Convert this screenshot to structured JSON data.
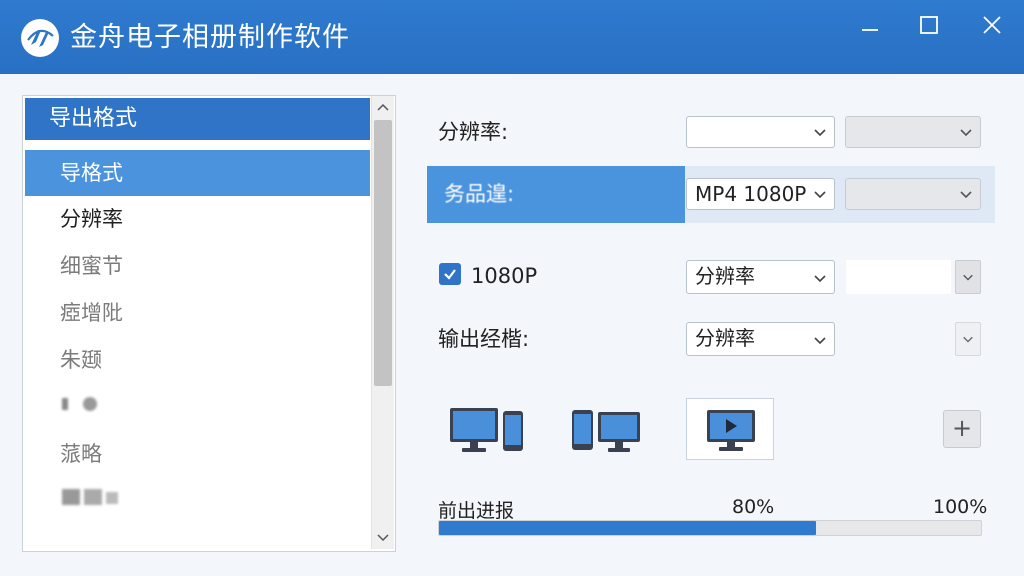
{
  "window": {
    "title": "金舟电子相册制作软件",
    "accent_color": "#2f74c6",
    "controls": [
      "minimize-icon",
      "maximize-icon",
      "close-icon"
    ]
  },
  "sidebar": {
    "header": "导出格式",
    "items": [
      {
        "label": "导格式",
        "state": "selected"
      },
      {
        "label": "分辨率",
        "state": "normal"
      },
      {
        "label": "细蜜节",
        "state": "muted"
      },
      {
        "label": "瘂增阰",
        "state": "muted"
      },
      {
        "label": "朱颋",
        "state": "muted"
      },
      {
        "label": "",
        "state": "blurred"
      },
      {
        "label": "蒎略",
        "state": "muted"
      },
      {
        "label": "",
        "state": "blurred"
      }
    ]
  },
  "columns": {
    "head1": "",
    "head2": ""
  },
  "rows": {
    "resolution": {
      "label": "分辨率:",
      "select1": "",
      "select2": ""
    },
    "format": {
      "label": "务品遑:",
      "select1": "MP4 1080P",
      "select2": ""
    },
    "hd": {
      "checkbox_checked": true,
      "label": "1080P",
      "select1": "分辨率"
    },
    "output": {
      "label": "输出经楷:",
      "select1": "分辨率"
    }
  },
  "devices": [
    {
      "name": "desktop-phone-icon",
      "selected": false
    },
    {
      "name": "phone-monitor-icon",
      "selected": false
    },
    {
      "name": "video-monitor-icon",
      "selected": true
    }
  ],
  "plus_label": "+",
  "progress": {
    "label": "前出进报",
    "mid_label": "80%",
    "end_label": "100%",
    "value_fraction": 0.695
  }
}
